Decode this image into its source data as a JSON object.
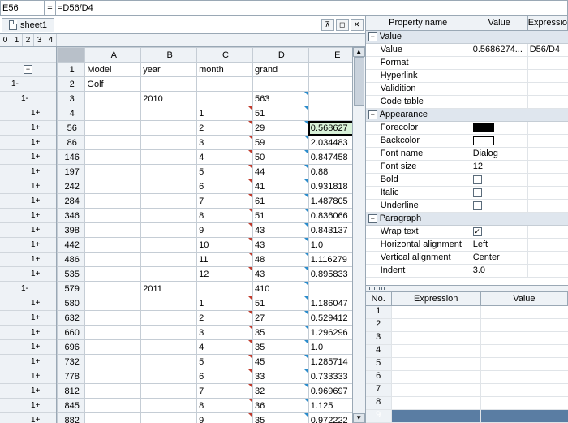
{
  "formula_bar": {
    "cell_ref": "E56",
    "eq": "=",
    "formula": "=D56/D4"
  },
  "tab": {
    "name": "sheet1"
  },
  "outline_levels": [
    "0",
    "1",
    "2",
    "3",
    "4"
  ],
  "grid": {
    "col_labels": [
      "A",
      "B",
      "C",
      "D",
      "E"
    ],
    "header_row": {
      "num": "1",
      "A": "Model",
      "B": "year",
      "C": "month",
      "D": "grand",
      "E": ""
    },
    "rows": [
      {
        "num": "2",
        "dark": false,
        "o1": "1-",
        "o2": "",
        "o3": "",
        "A": "Golf",
        "B": "",
        "C": "",
        "D": "",
        "E": ""
      },
      {
        "num": "3",
        "dark": false,
        "o1": "",
        "o2": "1-",
        "o3": "",
        "A": "",
        "B": "2010",
        "C": "",
        "D": "563",
        "E": ""
      },
      {
        "num": "4",
        "dark": true,
        "o1": "",
        "o2": "",
        "o3": "1+",
        "A": "",
        "B": "",
        "C": "1",
        "D": "51",
        "E": ""
      },
      {
        "num": "56",
        "dark": true,
        "o1": "",
        "o2": "",
        "o3": "1+",
        "A": "",
        "B": "",
        "C": "2",
        "D": "29",
        "E": "0.568627",
        "sel": true
      },
      {
        "num": "86",
        "dark": true,
        "o1": "",
        "o2": "",
        "o3": "1+",
        "A": "",
        "B": "",
        "C": "3",
        "D": "59",
        "E": "2.034483"
      },
      {
        "num": "146",
        "dark": true,
        "o1": "",
        "o2": "",
        "o3": "1+",
        "A": "",
        "B": "",
        "C": "4",
        "D": "50",
        "E": "0.847458"
      },
      {
        "num": "197",
        "dark": true,
        "o1": "",
        "o2": "",
        "o3": "1+",
        "A": "",
        "B": "",
        "C": "5",
        "D": "44",
        "E": "0.88"
      },
      {
        "num": "242",
        "dark": true,
        "o1": "",
        "o2": "",
        "o3": "1+",
        "A": "",
        "B": "",
        "C": "6",
        "D": "41",
        "E": "0.931818"
      },
      {
        "num": "284",
        "dark": true,
        "o1": "",
        "o2": "",
        "o3": "1+",
        "A": "",
        "B": "",
        "C": "7",
        "D": "61",
        "E": "1.487805"
      },
      {
        "num": "346",
        "dark": true,
        "o1": "",
        "o2": "",
        "o3": "1+",
        "A": "",
        "B": "",
        "C": "8",
        "D": "51",
        "E": "0.836066"
      },
      {
        "num": "398",
        "dark": true,
        "o1": "",
        "o2": "",
        "o3": "1+",
        "A": "",
        "B": "",
        "C": "9",
        "D": "43",
        "E": "0.843137"
      },
      {
        "num": "442",
        "dark": true,
        "o1": "",
        "o2": "",
        "o3": "1+",
        "A": "",
        "B": "",
        "C": "10",
        "D": "43",
        "E": "1.0"
      },
      {
        "num": "486",
        "dark": true,
        "o1": "",
        "o2": "",
        "o3": "1+",
        "A": "",
        "B": "",
        "C": "11",
        "D": "48",
        "E": "1.116279"
      },
      {
        "num": "535",
        "dark": true,
        "o1": "",
        "o2": "",
        "o3": "1+",
        "A": "",
        "B": "",
        "C": "12",
        "D": "43",
        "E": "0.895833"
      },
      {
        "num": "579",
        "dark": false,
        "o1": "",
        "o2": "1-",
        "o3": "",
        "A": "",
        "B": "2011",
        "C": "",
        "D": "410",
        "E": ""
      },
      {
        "num": "580",
        "dark": true,
        "o1": "",
        "o2": "",
        "o3": "1+",
        "A": "",
        "B": "",
        "C": "1",
        "D": "51",
        "E": "1.186047"
      },
      {
        "num": "632",
        "dark": true,
        "o1": "",
        "o2": "",
        "o3": "1+",
        "A": "",
        "B": "",
        "C": "2",
        "D": "27",
        "E": "0.529412"
      },
      {
        "num": "660",
        "dark": true,
        "o1": "",
        "o2": "",
        "o3": "1+",
        "A": "",
        "B": "",
        "C": "3",
        "D": "35",
        "E": "1.296296"
      },
      {
        "num": "696",
        "dark": true,
        "o1": "",
        "o2": "",
        "o3": "1+",
        "A": "",
        "B": "",
        "C": "4",
        "D": "35",
        "E": "1.0"
      },
      {
        "num": "732",
        "dark": true,
        "o1": "",
        "o2": "",
        "o3": "1+",
        "A": "",
        "B": "",
        "C": "5",
        "D": "45",
        "E": "1.285714"
      },
      {
        "num": "778",
        "dark": true,
        "o1": "",
        "o2": "",
        "o3": "1+",
        "A": "",
        "B": "",
        "C": "6",
        "D": "33",
        "E": "0.733333"
      },
      {
        "num": "812",
        "dark": true,
        "o1": "",
        "o2": "",
        "o3": "1+",
        "A": "",
        "B": "",
        "C": "7",
        "D": "32",
        "E": "0.969697"
      },
      {
        "num": "845",
        "dark": true,
        "o1": "",
        "o2": "",
        "o3": "1+",
        "A": "",
        "B": "",
        "C": "8",
        "D": "36",
        "E": "1.125"
      },
      {
        "num": "882",
        "dark": true,
        "o1": "",
        "o2": "",
        "o3": "1+",
        "A": "",
        "B": "",
        "C": "9",
        "D": "35",
        "E": "0.972222"
      }
    ]
  },
  "prop": {
    "head": {
      "name": "Property name",
      "value": "Value",
      "expr": "Expressio"
    },
    "groups": [
      {
        "label": "Value",
        "rows": [
          {
            "name": "Value",
            "val": "0.5686274...",
            "exp": "D56/D4"
          },
          {
            "name": "Format",
            "val": "",
            "exp": ""
          },
          {
            "name": "Hyperlink",
            "val": "",
            "exp": ""
          },
          {
            "name": "Validition",
            "val": "",
            "exp": ""
          },
          {
            "name": "Code table",
            "val": "",
            "exp": ""
          }
        ]
      },
      {
        "label": "Appearance",
        "rows": [
          {
            "name": "Forecolor",
            "val": "",
            "exp": "",
            "swatch": "#000000"
          },
          {
            "name": "Backcolor",
            "val": "",
            "exp": "",
            "swatch": "#ffffff"
          },
          {
            "name": "Font name",
            "val": "Dialog",
            "exp": ""
          },
          {
            "name": "Font size",
            "val": "12",
            "exp": ""
          },
          {
            "name": "Bold",
            "val": "",
            "exp": "",
            "check": false
          },
          {
            "name": "Italic",
            "val": "",
            "exp": "",
            "check": false
          },
          {
            "name": "Underline",
            "val": "",
            "exp": "",
            "check": false
          }
        ]
      },
      {
        "label": "Paragraph",
        "rows": [
          {
            "name": "Wrap text",
            "val": "",
            "exp": "",
            "check": true
          },
          {
            "name": "Horizontal alignment",
            "val": "Left",
            "exp": ""
          },
          {
            "name": "Vertical alignment",
            "val": "Center",
            "exp": ""
          },
          {
            "name": "Indent",
            "val": "3.0",
            "exp": ""
          }
        ]
      }
    ]
  },
  "expr_table": {
    "head": {
      "no": "No.",
      "expr": "Expression",
      "val": "Value"
    },
    "rows": [
      {
        "no": "1"
      },
      {
        "no": "2"
      },
      {
        "no": "3"
      },
      {
        "no": "4"
      },
      {
        "no": "5"
      },
      {
        "no": "6"
      },
      {
        "no": "7"
      },
      {
        "no": "8"
      },
      {
        "no": "9",
        "sel": true
      }
    ]
  }
}
